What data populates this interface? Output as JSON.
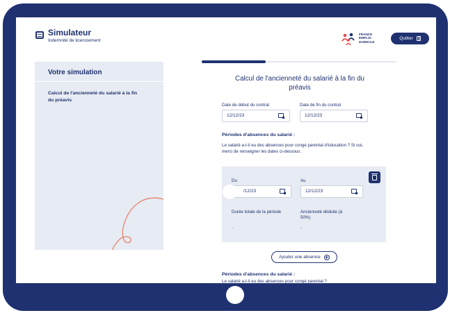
{
  "header": {
    "app_title": "Simulateur",
    "app_subtitle": "Indemnité de licenciement",
    "logo_lines": [
      "FRANCE",
      "EMPLOI",
      "DOMICILE"
    ],
    "quit_label": "Quitter",
    "icons": [
      "document-icon",
      "logout-icon"
    ]
  },
  "sidebar": {
    "title": "Votre simulation",
    "items": [
      {
        "label": "Calcul de l'ancienneté du salarié à la fin du préavis"
      }
    ]
  },
  "progress": {
    "fraction": 0.33
  },
  "main": {
    "title": "Calcul de l'ancienneté du salarié à la fin du préavis",
    "start_date": {
      "label": "Date de début du contrat",
      "value": "12/12/23"
    },
    "end_date": {
      "label": "Date de fin du contrat",
      "value": "12/12/23"
    },
    "absences_heading": "Périodes d'absences du salarié :",
    "absences_question": "Le salarié a-t-il eu des absences pour congé parental d'éducation ? Si oui, merci de renseigner les dates ci-dessous :",
    "absence": {
      "from_label": "Du",
      "from_value": "/12/23",
      "to_label": "Au",
      "to_value": "12/12/23",
      "duration_label": "Durée totale de la période",
      "duration_value": "-",
      "deducted_label": "Ancienneté déduite (à 50%)",
      "deducted_value": "-"
    },
    "add_absence_label": "Ajouter une absence",
    "absences_heading_2": "Périodes d'absences du salarié :",
    "cut_off_text": "Le salarié a-t-il eu des absences pour congé parental ?"
  },
  "colors": {
    "navy": "#1f3170",
    "panel": "#e7ebf3",
    "logo_red": "#e4484a"
  }
}
